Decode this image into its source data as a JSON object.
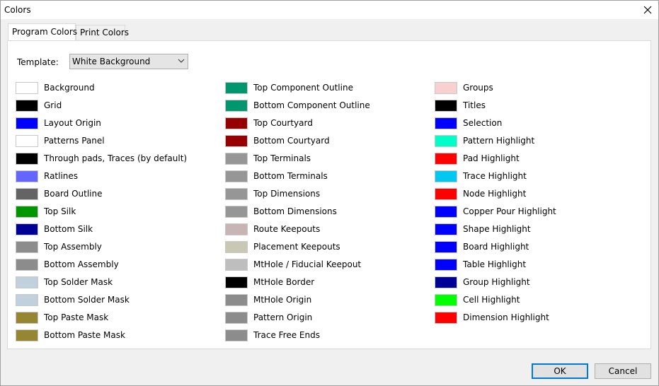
{
  "window": {
    "title": "Colors"
  },
  "tabs": [
    {
      "label": "Program Colors",
      "active": true
    },
    {
      "label": "Print Colors",
      "active": false
    }
  ],
  "template": {
    "label": "Template:",
    "value": "White Background"
  },
  "columns": [
    [
      {
        "label": "Background",
        "color": "#ffffff"
      },
      {
        "label": "Grid",
        "color": "#000000"
      },
      {
        "label": "Layout Origin",
        "color": "#0000ff"
      },
      {
        "label": "Patterns Panel",
        "color": "#ffffff"
      },
      {
        "label": "Through pads, Traces (by default)",
        "color": "#000000"
      },
      {
        "label": "Ratlines",
        "color": "#6464ff"
      },
      {
        "label": "Board Outline",
        "color": "#646464"
      },
      {
        "label": "Top Silk",
        "color": "#009600"
      },
      {
        "label": "Bottom Silk",
        "color": "#000096"
      },
      {
        "label": "Top Assembly",
        "color": "#8c8c8c"
      },
      {
        "label": "Bottom Assembly",
        "color": "#8c8c8c"
      },
      {
        "label": "Top Solder Mask",
        "color": "#c0d0dc"
      },
      {
        "label": "Bottom Solder Mask",
        "color": "#c0d0dc"
      },
      {
        "label": "Top Paste Mask",
        "color": "#968632"
      },
      {
        "label": "Bottom Paste Mask",
        "color": "#968632"
      }
    ],
    [
      {
        "label": "Top Component Outline",
        "color": "#00966e"
      },
      {
        "label": "Bottom Component Outline",
        "color": "#00966e"
      },
      {
        "label": "Top Courtyard",
        "color": "#960000"
      },
      {
        "label": "Bottom Courtyard",
        "color": "#960000"
      },
      {
        "label": "Top Terminals",
        "color": "#969696"
      },
      {
        "label": "Bottom Terminals",
        "color": "#969696"
      },
      {
        "label": "Top Dimensions",
        "color": "#969696"
      },
      {
        "label": "Bottom Dimensions",
        "color": "#969696"
      },
      {
        "label": "Route Keepouts",
        "color": "#c8b4b4"
      },
      {
        "label": "Placement Keepouts",
        "color": "#c8c8b4"
      },
      {
        "label": "MtHole / Fiducial Keepout",
        "color": "#bebebe"
      },
      {
        "label": "MtHole Border",
        "color": "#000000"
      },
      {
        "label": "MtHole Origin",
        "color": "#8c8c8c"
      },
      {
        "label": "Pattern Origin",
        "color": "#8c8c8c"
      },
      {
        "label": "Trace Free Ends",
        "color": "#8c8c8c"
      }
    ],
    [
      {
        "label": "Groups",
        "color": "#f8d0d0"
      },
      {
        "label": "Titles",
        "color": "#000000"
      },
      {
        "label": "Selection",
        "color": "#0000ff"
      },
      {
        "label": "Pattern Highlight",
        "color": "#00ffc8"
      },
      {
        "label": "Pad Highlight",
        "color": "#ff0000"
      },
      {
        "label": "Trace Highlight",
        "color": "#00c8f0"
      },
      {
        "label": "Node Highlight",
        "color": "#ff0000"
      },
      {
        "label": "Copper Pour Highlight",
        "color": "#0000ff"
      },
      {
        "label": "Shape Highlight",
        "color": "#0000ff"
      },
      {
        "label": "Board Highlight",
        "color": "#0000ff"
      },
      {
        "label": "Table Highlight",
        "color": "#0000ff"
      },
      {
        "label": "Group Highlight",
        "color": "#000096"
      },
      {
        "label": "Cell Highlight",
        "color": "#00ff00"
      },
      {
        "label": "Dimension Highlight",
        "color": "#ff0000"
      }
    ]
  ],
  "buttons": {
    "ok": "OK",
    "cancel": "Cancel"
  }
}
